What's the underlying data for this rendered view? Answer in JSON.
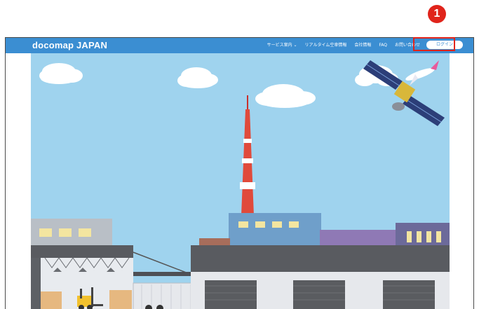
{
  "header": {
    "brand": "docomap JAPAN",
    "nav": [
      {
        "label": "サービス案内 ⌄"
      },
      {
        "label": "リアルタイム空車情報"
      },
      {
        "label": "会社情報"
      },
      {
        "label": "FAQ"
      },
      {
        "label": "お問い合わせ"
      }
    ],
    "login_label": "ログイン"
  },
  "annotation": {
    "step_number": "1"
  },
  "colors": {
    "nav_bar": "#3b8ed2",
    "sky": "#9fd3ee",
    "highlight": "#e0241b",
    "truck_cab": "#2f73c9"
  }
}
